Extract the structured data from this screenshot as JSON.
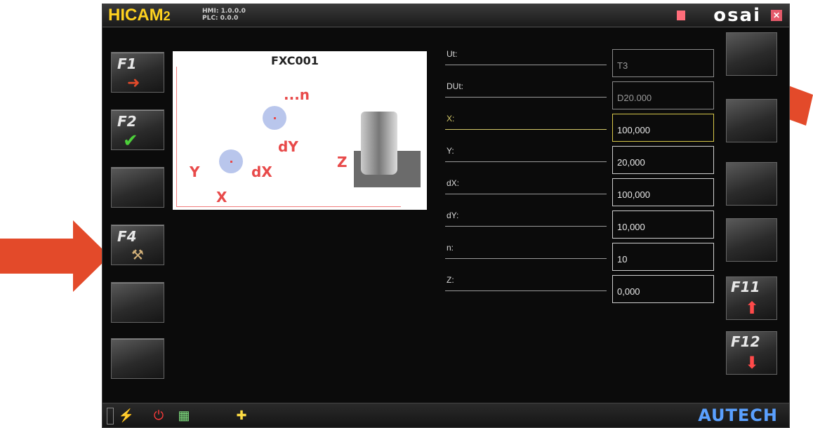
{
  "app": {
    "brand": "HICAM",
    "brand_sub": "2",
    "hmi_version": "HMI: 1.0.0.0",
    "plc_version": "PLC: 0.0.0",
    "vendor_logo": "osai",
    "close_icon": "close-icon"
  },
  "left_keys": [
    {
      "label": "F1",
      "icon": "exit-icon"
    },
    {
      "label": "F2",
      "icon": "check-icon"
    },
    {
      "label": "",
      "icon": ""
    },
    {
      "label": "F4",
      "icon": "tool-icon"
    },
    {
      "label": "",
      "icon": ""
    },
    {
      "label": "",
      "icon": ""
    }
  ],
  "diagram": {
    "title": "FXC001",
    "labels": {
      "n": "...n",
      "dY": "dY",
      "Y": "Y",
      "dX": "dX",
      "X": "X",
      "Z": "Z"
    }
  },
  "fields": [
    {
      "name": "Ut:",
      "value": "T3"
    },
    {
      "name": "DUt:",
      "value": "D20.000"
    },
    {
      "name": "X:",
      "value": "100,000"
    },
    {
      "name": "Y:",
      "value": "20,000"
    },
    {
      "name": "dX:",
      "value": "100,000"
    },
    {
      "name": "dY:",
      "value": "10,000"
    },
    {
      "name": "n:",
      "value": "10"
    },
    {
      "name": "Z:",
      "value": "0,000"
    }
  ],
  "right_keys": [
    {
      "label": "",
      "icon": ""
    },
    {
      "label": "",
      "icon": ""
    },
    {
      "label": "",
      "icon": ""
    },
    {
      "label": "",
      "icon": ""
    },
    {
      "label": "F11",
      "icon": "arrow-up-icon"
    },
    {
      "label": "F12",
      "icon": "arrow-down-icon"
    }
  ],
  "status": {
    "brand": "AUTECH",
    "icons": [
      "battery-icon",
      "power-flash-icon",
      "power-button-icon",
      "calculator-icon",
      "tool-change-icon"
    ]
  },
  "colors": {
    "accent_yellow": "#ffd21f",
    "diagram_red": "#e84a4a",
    "active_field": "#d8c84a",
    "annotation_arrow": "#e34a2a"
  }
}
